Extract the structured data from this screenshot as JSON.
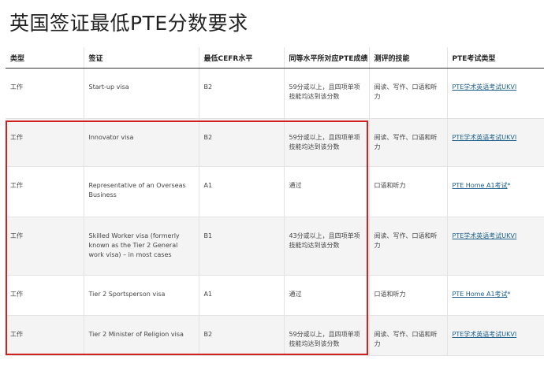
{
  "page": {
    "title": "英国签证最低PTE分数要求"
  },
  "table": {
    "headers": [
      "类型",
      "签证",
      "最低CEFR水平",
      "同等水平所对应PTE成绩",
      "测评的技能",
      "PTE考试类型"
    ],
    "rows": [
      {
        "type": "工作",
        "visa": "Start-up visa",
        "cefr": "B2",
        "pte": "59分或以上，且四项单项技能均达到该分数",
        "skills": "阅读、写作、口语和听力",
        "test": "PTE学术英语考试UKVI",
        "test_star": ""
      },
      {
        "type": "工作",
        "visa": "Innovator visa",
        "cefr": "B2",
        "pte": "59分或以上，且四项单项技能均达到该分数",
        "skills": "阅读、写作、口语和听力",
        "test": "PTE学术英语考试UKVI",
        "test_star": ""
      },
      {
        "type": "工作",
        "visa": "Representative of an Overseas Business",
        "cefr": "A1",
        "pte": "通过",
        "skills": "口语和听力",
        "test": "PTE Home A1考试",
        "test_star": "*"
      },
      {
        "type": "工作",
        "visa": "Skilled Worker visa (formerly known as the Tier 2 General work visa) – in most cases",
        "cefr": "B1",
        "pte": "43分或以上，且四项单项技能均达到该分数",
        "skills": "阅读、写作、口语和听力",
        "test": "PTE学术英语考试UKVI",
        "test_star": ""
      },
      {
        "type": "工作",
        "visa": "Tier 2 Sportsperson visa",
        "cefr": "A1",
        "pte": "通过",
        "skills": "口语和听力",
        "test": "PTE Home A1考试",
        "test_star": "*"
      },
      {
        "type": "工作",
        "visa": "Tier 2 Minister of Religion visa",
        "cefr": "B2",
        "pte": "59分或以上，且四项单项技能均达到该分数",
        "skills": "阅读、写作、口语和听力",
        "test": "PTE学术英语考试UKVI",
        "test_star": ""
      }
    ]
  },
  "colors": {
    "highlight_border": "#d21f1f",
    "link": "#1b5f8a",
    "alt_row": "#f4f4f4"
  }
}
